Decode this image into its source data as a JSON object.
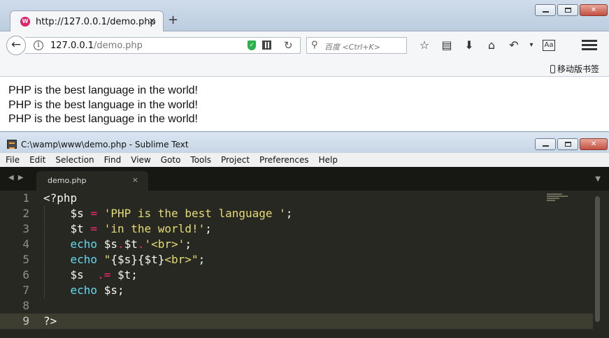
{
  "firefox": {
    "tab_title": "http://127.0.0.1/demo.php",
    "tab_close": "×",
    "new_tab": "+",
    "url_host": "127.0.0.1",
    "url_path": "/demo.php",
    "search_placeholder": "百度 <Ctrl+K>",
    "mobile_bookmarks": "移动版书签",
    "content_lines": [
      "PHP is the best language in the world!",
      "PHP is the best language in the world!",
      "PHP is the best language in the world!"
    ]
  },
  "sublime": {
    "title": "C:\\wamp\\www\\demo.php - Sublime Text",
    "menu": [
      "File",
      "Edit",
      "Selection",
      "Find",
      "View",
      "Goto",
      "Tools",
      "Project",
      "Preferences",
      "Help"
    ],
    "tab_label": "demo.php",
    "tab_close": "×",
    "line_numbers": [
      "1",
      "2",
      "3",
      "4",
      "5",
      "6",
      "7",
      "8",
      "9"
    ],
    "active_line": 9,
    "code": {
      "l1": "<?php",
      "l2_var": "$s",
      "l2_op": "=",
      "l2_str": "'PHP is the best language '",
      "l2_end": ";",
      "l3_var": "$t",
      "l3_op": "=",
      "l3_str": "'in the world!'",
      "l3_end": ";",
      "l4_fn": "echo",
      "l4_a": "$s",
      "l4_dot1": ".",
      "l4_b": "$t",
      "l4_dot2": ".",
      "l4_str": "'<br>'",
      "l4_end": ";",
      "l5_fn": "echo",
      "l5_q1": "\"",
      "l5_interp": "{$s}{$t}",
      "l5_tail": "<br>\"",
      "l5_end": ";",
      "l6_var": "$s",
      "l6_op": ".=",
      "l6_b": "$t",
      "l6_end": ";",
      "l7_fn": "echo",
      "l7_a": "$s",
      "l7_end": ";",
      "l9": "?>"
    },
    "colors": {
      "background": "#272822",
      "keyword": "#f92672",
      "string": "#e6db74",
      "function": "#66d9ef",
      "text": "#f8f8f2"
    }
  }
}
